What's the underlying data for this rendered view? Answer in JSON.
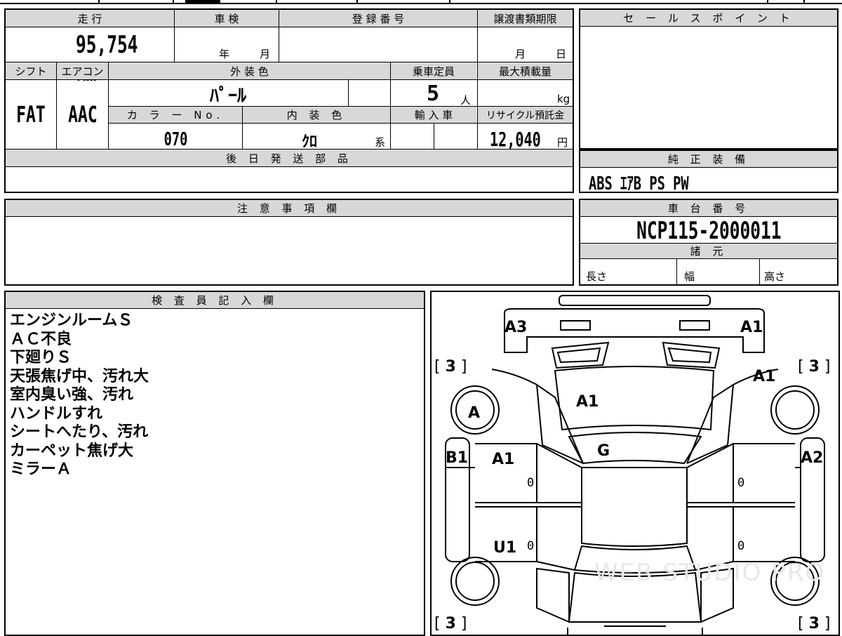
{
  "vehicle": {
    "mileage_label": "走 行",
    "mileage_value": "95,754",
    "mileage_unit": "km",
    "inspection_label": "車 検",
    "inspection_year": "年",
    "inspection_month": "月",
    "registration_label": "登 録 番 号",
    "transfer_label": "譲渡書類期限",
    "transfer_month": "月",
    "transfer_day": "日",
    "shift_label": "シフト",
    "shift_value": "FAT",
    "ac_label": "エアコン",
    "ac_value": "AAC",
    "exterior_label": "外 装 色",
    "exterior_value": "ﾊﾟｰﾙ",
    "capacity_label": "乗車定員",
    "capacity_value": "5",
    "capacity_unit": "人",
    "load_label": "最大積載量",
    "load_unit": "kg",
    "color_no_label": "カ ラ ー No.",
    "color_no_value": "070",
    "interior_label": "内 装 色",
    "interior_value": "ｸﾛ",
    "interior_suffix": "系",
    "import_label": "輸 入 車",
    "recycle_label": "リサイクル預託金",
    "recycle_value": "12,040",
    "recycle_unit": "円",
    "later_parts_label": "後 日 発 送 部 品"
  },
  "sales_point": {
    "label": "セ ー ル ス ポ イ ン ト"
  },
  "equipment": {
    "label": "純 正 装 備",
    "value": "ABS ｴｱB PS PW"
  },
  "caution": {
    "label": "注 意 事 項 欄"
  },
  "chassis": {
    "label": "車 台 番 号",
    "value": "NCP115-2000011",
    "specs_label": "諸 元",
    "length_label": "長さ",
    "width_label": "幅",
    "height_label": "高さ"
  },
  "inspector": {
    "label": "検 査 員 記 入 欄",
    "notes": [
      "エンジンルームＳ",
      "ＡＣ不良",
      "下廻りＳ",
      "天張焦げ中、汚れ大",
      "室内臭い強、汚れ",
      "ハンドルすれ",
      "シートへたり、汚れ",
      "カーペット焦げ大",
      "ミラーＡ"
    ]
  },
  "diagram": {
    "tire_fl": "3",
    "tire_fr": "3",
    "tire_rl": "3",
    "tire_rr": "3",
    "bracket_open": "[",
    "bracket_close": "]",
    "front_left": "A3",
    "front_right": "A1",
    "right_fender": "A1",
    "hood": "A1",
    "left_wheel": "A",
    "windshield": "G",
    "left_pillar": "B1",
    "left_door": "A1",
    "right_side": "A2",
    "left_rear_door": "U1",
    "zero": "0",
    "watermark": "WEB STUDIO PRO"
  }
}
